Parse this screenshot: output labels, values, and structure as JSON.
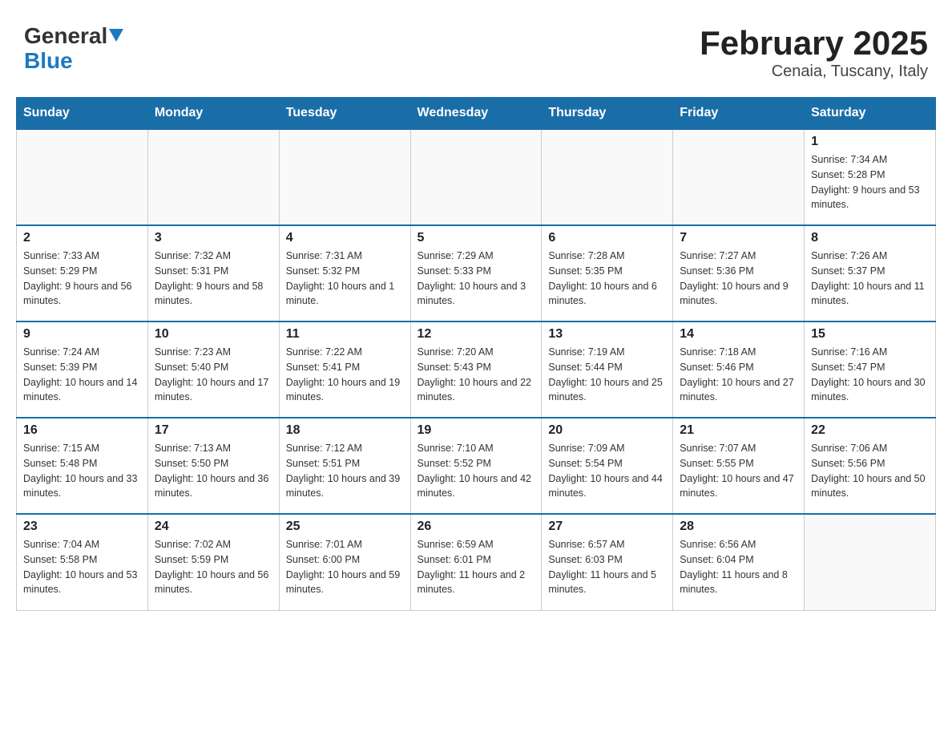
{
  "header": {
    "logo_text_general": "General",
    "logo_text_blue": "Blue",
    "title": "February 2025",
    "subtitle": "Cenaia, Tuscany, Italy"
  },
  "days_of_week": [
    "Sunday",
    "Monday",
    "Tuesday",
    "Wednesday",
    "Thursday",
    "Friday",
    "Saturday"
  ],
  "weeks": [
    [
      {
        "day": "",
        "sunrise": "",
        "sunset": "",
        "daylight": ""
      },
      {
        "day": "",
        "sunrise": "",
        "sunset": "",
        "daylight": ""
      },
      {
        "day": "",
        "sunrise": "",
        "sunset": "",
        "daylight": ""
      },
      {
        "day": "",
        "sunrise": "",
        "sunset": "",
        "daylight": ""
      },
      {
        "day": "",
        "sunrise": "",
        "sunset": "",
        "daylight": ""
      },
      {
        "day": "",
        "sunrise": "",
        "sunset": "",
        "daylight": ""
      },
      {
        "day": "1",
        "sunrise": "Sunrise: 7:34 AM",
        "sunset": "Sunset: 5:28 PM",
        "daylight": "Daylight: 9 hours and 53 minutes."
      }
    ],
    [
      {
        "day": "2",
        "sunrise": "Sunrise: 7:33 AM",
        "sunset": "Sunset: 5:29 PM",
        "daylight": "Daylight: 9 hours and 56 minutes."
      },
      {
        "day": "3",
        "sunrise": "Sunrise: 7:32 AM",
        "sunset": "Sunset: 5:31 PM",
        "daylight": "Daylight: 9 hours and 58 minutes."
      },
      {
        "day": "4",
        "sunrise": "Sunrise: 7:31 AM",
        "sunset": "Sunset: 5:32 PM",
        "daylight": "Daylight: 10 hours and 1 minute."
      },
      {
        "day": "5",
        "sunrise": "Sunrise: 7:29 AM",
        "sunset": "Sunset: 5:33 PM",
        "daylight": "Daylight: 10 hours and 3 minutes."
      },
      {
        "day": "6",
        "sunrise": "Sunrise: 7:28 AM",
        "sunset": "Sunset: 5:35 PM",
        "daylight": "Daylight: 10 hours and 6 minutes."
      },
      {
        "day": "7",
        "sunrise": "Sunrise: 7:27 AM",
        "sunset": "Sunset: 5:36 PM",
        "daylight": "Daylight: 10 hours and 9 minutes."
      },
      {
        "day": "8",
        "sunrise": "Sunrise: 7:26 AM",
        "sunset": "Sunset: 5:37 PM",
        "daylight": "Daylight: 10 hours and 11 minutes."
      }
    ],
    [
      {
        "day": "9",
        "sunrise": "Sunrise: 7:24 AM",
        "sunset": "Sunset: 5:39 PM",
        "daylight": "Daylight: 10 hours and 14 minutes."
      },
      {
        "day": "10",
        "sunrise": "Sunrise: 7:23 AM",
        "sunset": "Sunset: 5:40 PM",
        "daylight": "Daylight: 10 hours and 17 minutes."
      },
      {
        "day": "11",
        "sunrise": "Sunrise: 7:22 AM",
        "sunset": "Sunset: 5:41 PM",
        "daylight": "Daylight: 10 hours and 19 minutes."
      },
      {
        "day": "12",
        "sunrise": "Sunrise: 7:20 AM",
        "sunset": "Sunset: 5:43 PM",
        "daylight": "Daylight: 10 hours and 22 minutes."
      },
      {
        "day": "13",
        "sunrise": "Sunrise: 7:19 AM",
        "sunset": "Sunset: 5:44 PM",
        "daylight": "Daylight: 10 hours and 25 minutes."
      },
      {
        "day": "14",
        "sunrise": "Sunrise: 7:18 AM",
        "sunset": "Sunset: 5:46 PM",
        "daylight": "Daylight: 10 hours and 27 minutes."
      },
      {
        "day": "15",
        "sunrise": "Sunrise: 7:16 AM",
        "sunset": "Sunset: 5:47 PM",
        "daylight": "Daylight: 10 hours and 30 minutes."
      }
    ],
    [
      {
        "day": "16",
        "sunrise": "Sunrise: 7:15 AM",
        "sunset": "Sunset: 5:48 PM",
        "daylight": "Daylight: 10 hours and 33 minutes."
      },
      {
        "day": "17",
        "sunrise": "Sunrise: 7:13 AM",
        "sunset": "Sunset: 5:50 PM",
        "daylight": "Daylight: 10 hours and 36 minutes."
      },
      {
        "day": "18",
        "sunrise": "Sunrise: 7:12 AM",
        "sunset": "Sunset: 5:51 PM",
        "daylight": "Daylight: 10 hours and 39 minutes."
      },
      {
        "day": "19",
        "sunrise": "Sunrise: 7:10 AM",
        "sunset": "Sunset: 5:52 PM",
        "daylight": "Daylight: 10 hours and 42 minutes."
      },
      {
        "day": "20",
        "sunrise": "Sunrise: 7:09 AM",
        "sunset": "Sunset: 5:54 PM",
        "daylight": "Daylight: 10 hours and 44 minutes."
      },
      {
        "day": "21",
        "sunrise": "Sunrise: 7:07 AM",
        "sunset": "Sunset: 5:55 PM",
        "daylight": "Daylight: 10 hours and 47 minutes."
      },
      {
        "day": "22",
        "sunrise": "Sunrise: 7:06 AM",
        "sunset": "Sunset: 5:56 PM",
        "daylight": "Daylight: 10 hours and 50 minutes."
      }
    ],
    [
      {
        "day": "23",
        "sunrise": "Sunrise: 7:04 AM",
        "sunset": "Sunset: 5:58 PM",
        "daylight": "Daylight: 10 hours and 53 minutes."
      },
      {
        "day": "24",
        "sunrise": "Sunrise: 7:02 AM",
        "sunset": "Sunset: 5:59 PM",
        "daylight": "Daylight: 10 hours and 56 minutes."
      },
      {
        "day": "25",
        "sunrise": "Sunrise: 7:01 AM",
        "sunset": "Sunset: 6:00 PM",
        "daylight": "Daylight: 10 hours and 59 minutes."
      },
      {
        "day": "26",
        "sunrise": "Sunrise: 6:59 AM",
        "sunset": "Sunset: 6:01 PM",
        "daylight": "Daylight: 11 hours and 2 minutes."
      },
      {
        "day": "27",
        "sunrise": "Sunrise: 6:57 AM",
        "sunset": "Sunset: 6:03 PM",
        "daylight": "Daylight: 11 hours and 5 minutes."
      },
      {
        "day": "28",
        "sunrise": "Sunrise: 6:56 AM",
        "sunset": "Sunset: 6:04 PM",
        "daylight": "Daylight: 11 hours and 8 minutes."
      },
      {
        "day": "",
        "sunrise": "",
        "sunset": "",
        "daylight": ""
      }
    ]
  ]
}
